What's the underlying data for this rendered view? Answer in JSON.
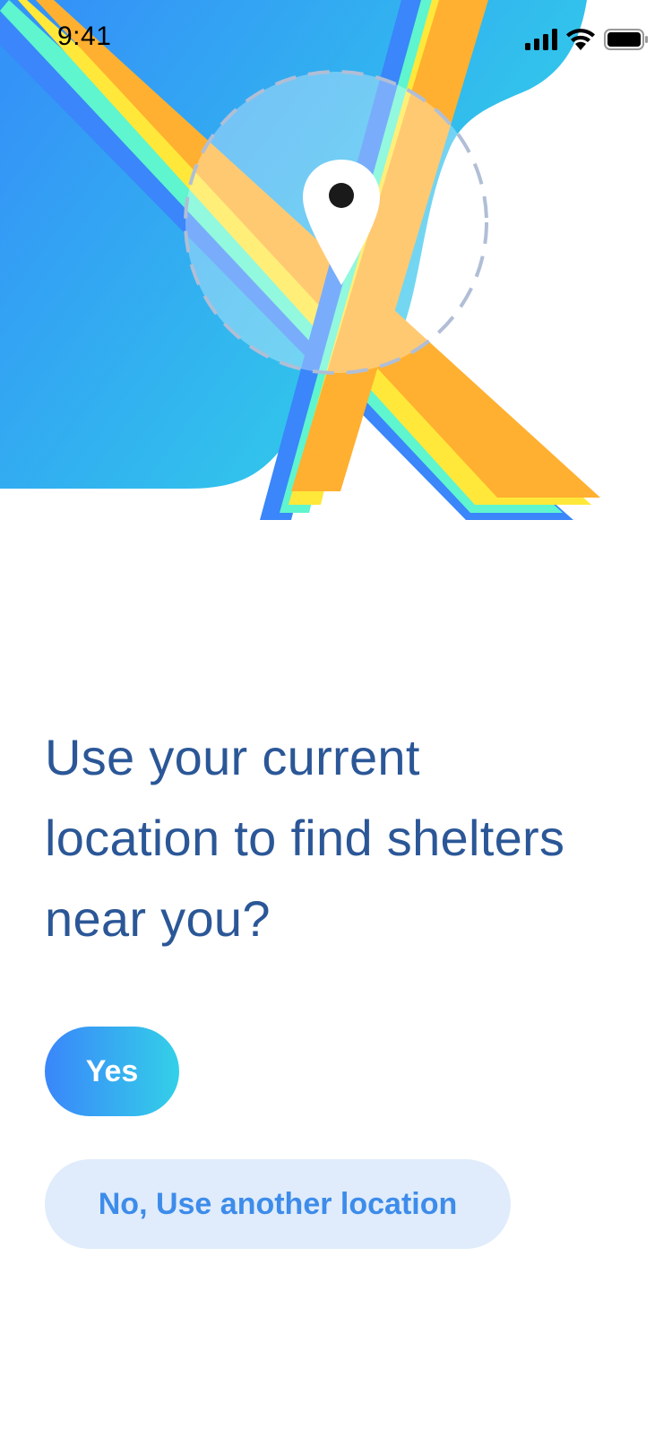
{
  "status_bar": {
    "time": "9:41",
    "icons": [
      "cellular-signal-icon",
      "wifi-icon",
      "battery-icon"
    ]
  },
  "hero": {
    "illustration": "map-with-location-pin",
    "icons": [
      "location-pin-icon"
    ]
  },
  "prompt": {
    "line1": "Use your current",
    "line2": "location to find shelters",
    "line3": "near you?"
  },
  "actions": {
    "yes_label": "Yes",
    "no_label": "No, Use another location"
  },
  "colors": {
    "heading": "#2B5797",
    "primary_gradient_start": "#3A86FA",
    "primary_gradient_end": "#33D0E8",
    "secondary_bg": "#E0ECFB",
    "secondary_text": "#3D8CEB",
    "road_orange": "#FFB030",
    "road_yellow": "#FFE83A",
    "road_mint": "#5FF5CF"
  }
}
